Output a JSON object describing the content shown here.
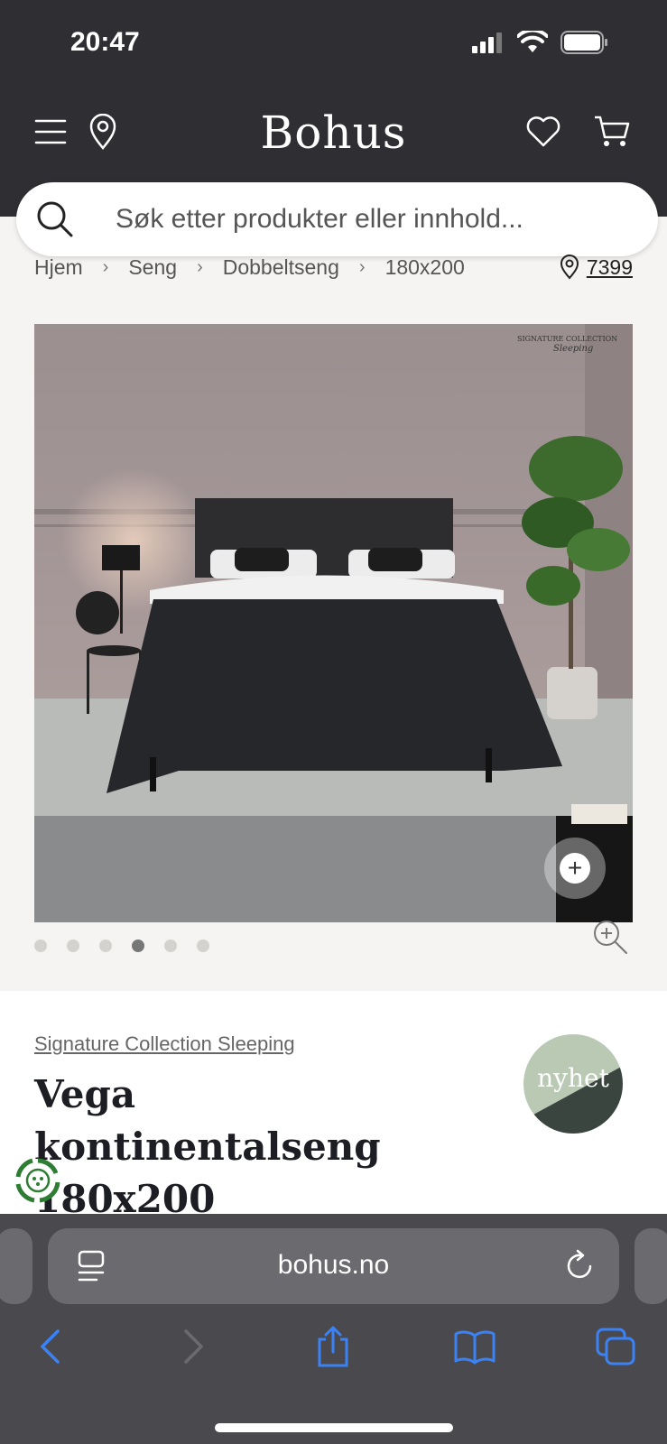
{
  "status": {
    "time": "20:47"
  },
  "header": {
    "logo": "Bohus"
  },
  "search": {
    "placeholder": "Søk etter produkter eller innhold..."
  },
  "breadcrumb": {
    "items": [
      "Hjem",
      "Seng",
      "Dobbeltseng",
      "180x200"
    ],
    "separator": "›"
  },
  "store": {
    "number": "7399"
  },
  "gallery": {
    "image_count": 6,
    "active_index": 3,
    "watermark_line1": "SIGNATURE COLLECTION",
    "watermark_line2": "Sleeping"
  },
  "product": {
    "brand": "Signature Collection Sleeping",
    "title": "Vega kontinentalseng 180x200",
    "badge": "nyhet"
  },
  "browser": {
    "url": "bohus.no"
  },
  "colors": {
    "header_bg": "#2e2e33",
    "badge_light": "#b9c9b4",
    "badge_dark": "#3a4540",
    "link_blue": "#3b82f6"
  }
}
